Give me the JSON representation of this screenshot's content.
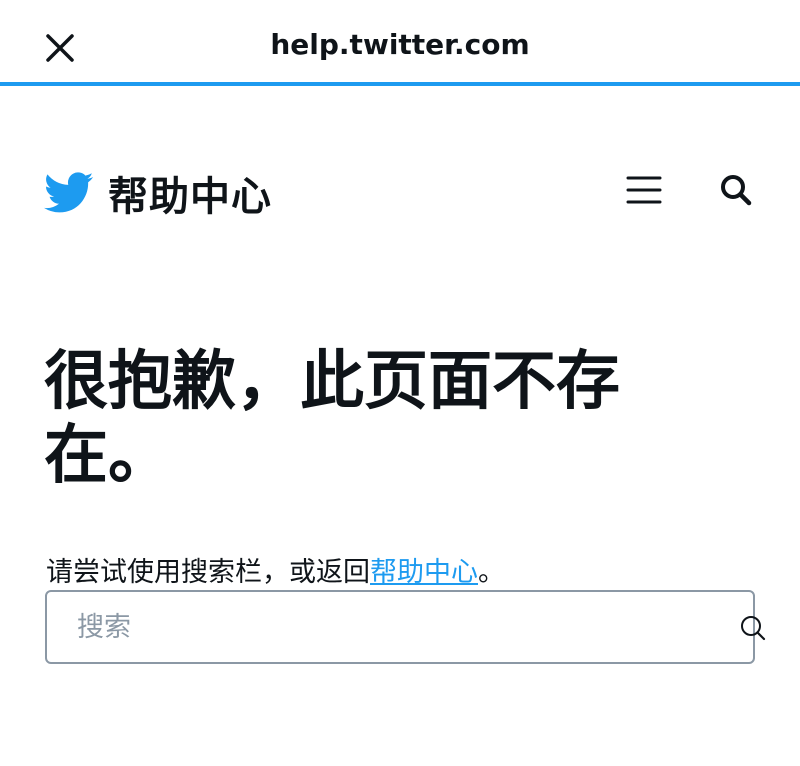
{
  "browser": {
    "url": "help.twitter.com",
    "close_icon": "close-icon"
  },
  "header": {
    "logo_icon": "twitter-bird-icon",
    "title": "帮助中心",
    "menu_icon": "hamburger-menu-icon",
    "search_icon": "search-icon",
    "brand_color": "#1d9bf0"
  },
  "main": {
    "heading": "很抱歉，此页面不存在。",
    "hint_text": "请尝试使用搜索栏，或返回",
    "hint_link": "帮助中心",
    "hint_suffix": "。",
    "search": {
      "placeholder": "搜索",
      "value": "",
      "icon": "search-icon"
    }
  }
}
